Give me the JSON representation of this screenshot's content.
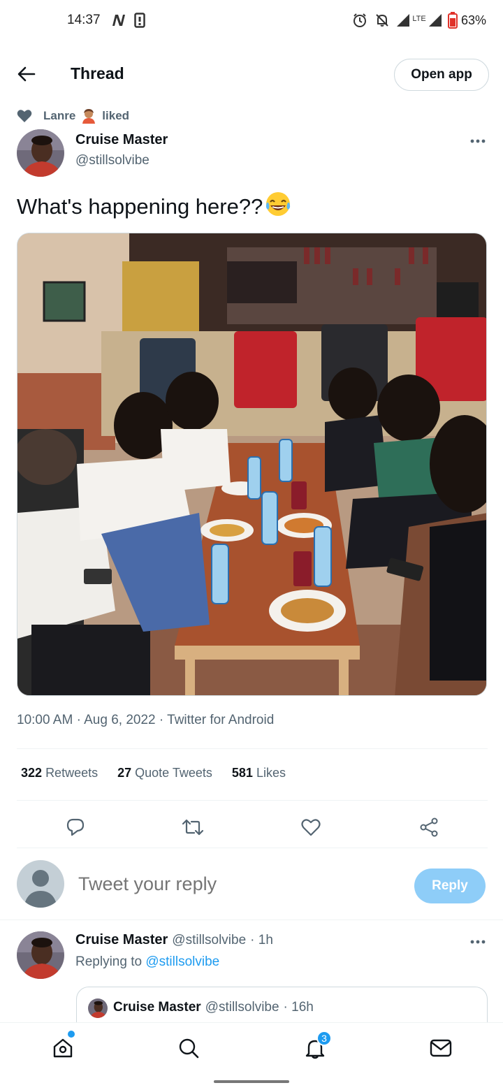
{
  "status_bar": {
    "time": "14:37",
    "battery": "63%",
    "network_label": "LTE",
    "icons": [
      "n-notification-icon",
      "sim-icon",
      "alarm-icon",
      "mute-icon",
      "signal-icon",
      "battery-icon"
    ]
  },
  "header": {
    "back_icon": "arrow-left-icon",
    "title": "Thread",
    "open_app_label": "Open app"
  },
  "social_context": {
    "icon": "heart-icon",
    "user": "Lanre",
    "emoji": "🧑🏽‍🦱",
    "action": "liked"
  },
  "tweet": {
    "author_name": "Cruise Master",
    "author_handle": "@stillsolvibe",
    "text": "What's happening here??",
    "emoji": "😂",
    "time": "10:00 AM",
    "date": "Aug 6, 2022",
    "source": "Twitter for Android",
    "separator": "·",
    "image_icon": "photo-restaurant-table"
  },
  "stats": {
    "retweets_count": "322",
    "retweets_label": "Retweets",
    "quotes_count": "27",
    "quotes_label": "Quote Tweets",
    "likes_count": "581",
    "likes_label": "Likes"
  },
  "actions": [
    "reply-icon",
    "retweet-icon",
    "like-icon",
    "share-icon"
  ],
  "reply_box": {
    "placeholder": "Tweet your reply",
    "button_label": "Reply"
  },
  "reply_tweet": {
    "author_name": "Cruise Master",
    "author_handle": "@stillsolvibe",
    "time": "· 1h",
    "replying_prefix": "Replying to",
    "replying_to": "@stillsolvibe",
    "quote": {
      "author_name": "Cruise Master",
      "author_handle": "@stillsolvibe",
      "time": "· 16h"
    }
  },
  "bottom_nav": {
    "items": [
      "home-icon",
      "search-icon",
      "notifications-icon",
      "messages-icon"
    ],
    "notification_count": "3"
  },
  "colors": {
    "accent": "#1d9bf0",
    "reply_button": "#8ecdf8",
    "secondary_text": "#536471",
    "primary_text": "#0f1419",
    "border": "#cfd9de"
  }
}
